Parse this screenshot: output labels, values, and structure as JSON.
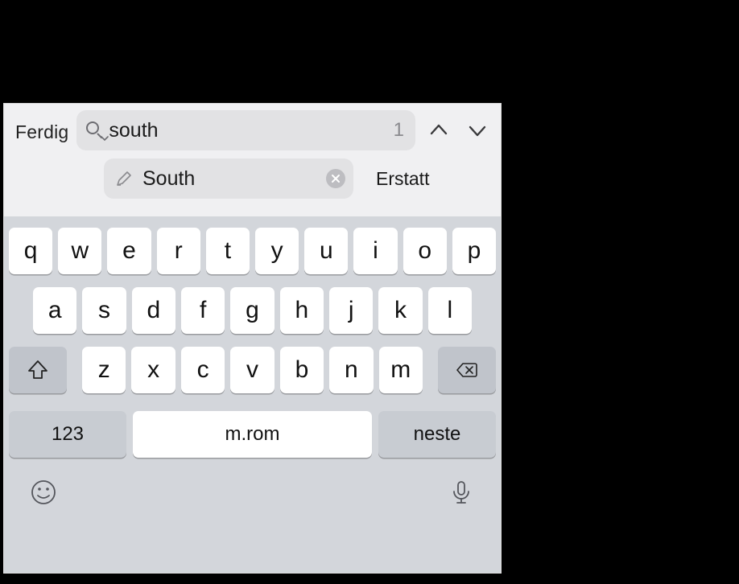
{
  "toolbar": {
    "done_label": "Ferdig",
    "search_value": "south",
    "result_count": "1",
    "replace_value": "South",
    "replace_action": "Erstatt"
  },
  "keyboard": {
    "row1": [
      "q",
      "w",
      "e",
      "r",
      "t",
      "y",
      "u",
      "i",
      "o",
      "p"
    ],
    "row2": [
      "a",
      "s",
      "d",
      "f",
      "g",
      "h",
      "j",
      "k",
      "l"
    ],
    "row3": [
      "z",
      "x",
      "c",
      "v",
      "b",
      "n",
      "m"
    ],
    "numbers_label": "123",
    "space_label": "m.rom",
    "next_label": "neste"
  }
}
